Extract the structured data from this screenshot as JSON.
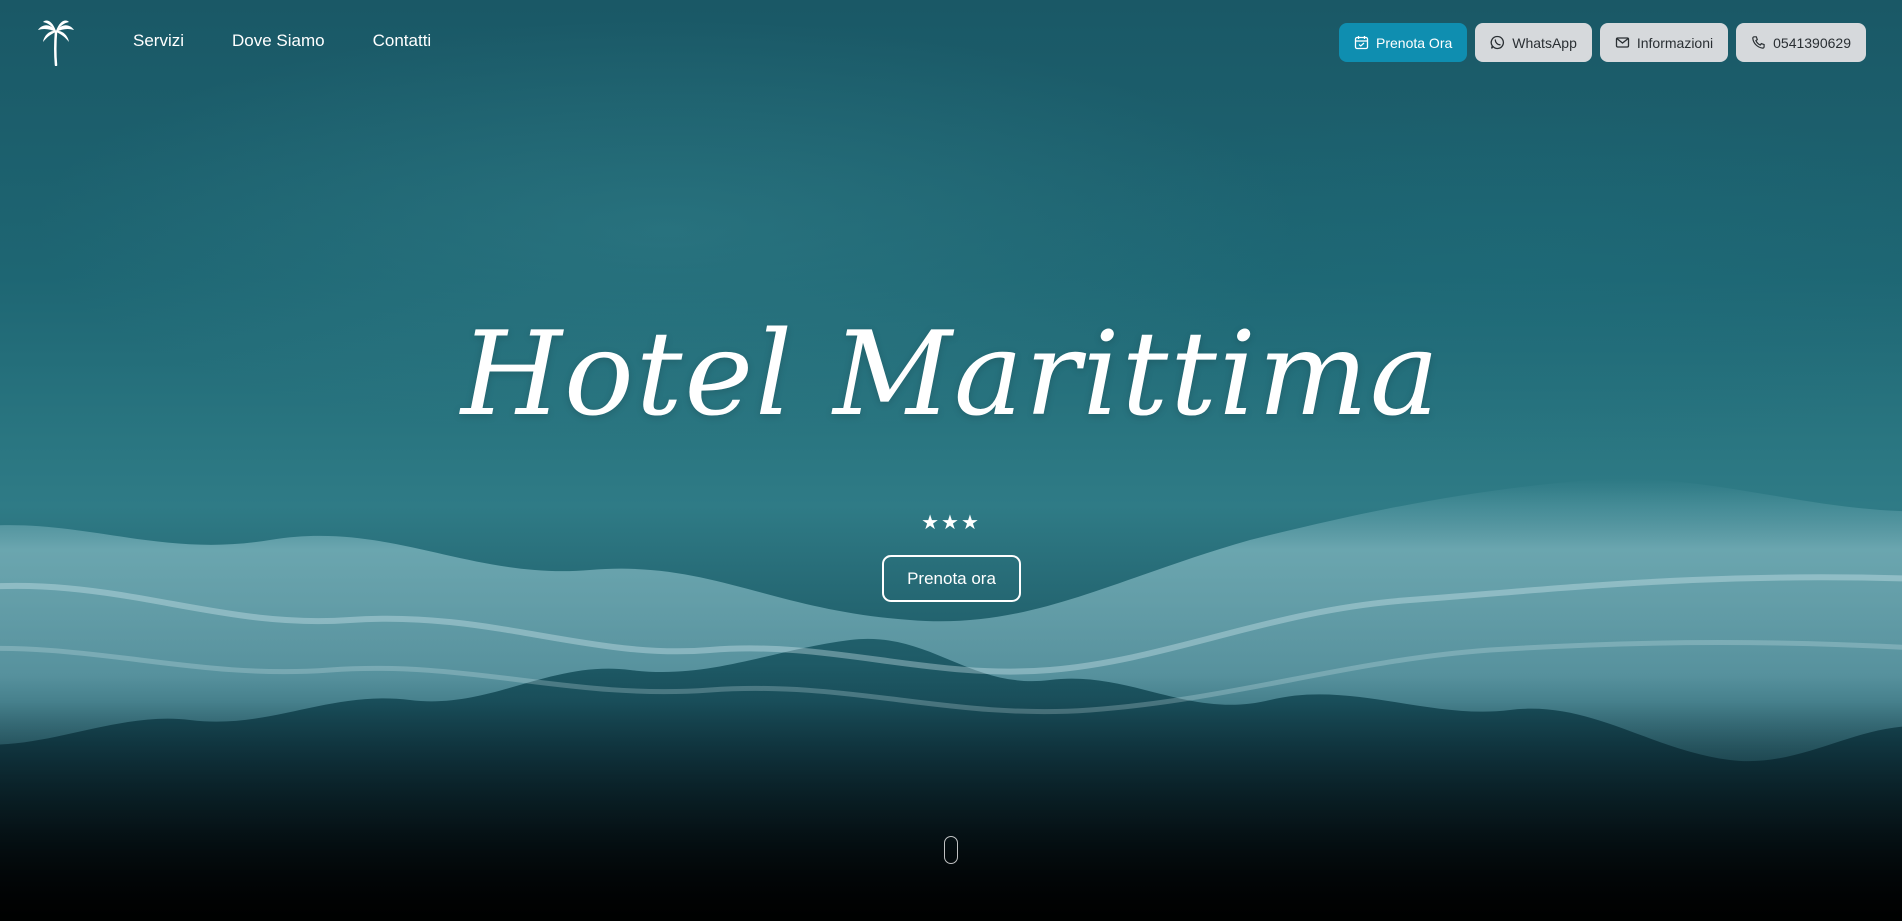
{
  "nav": {
    "items": [
      "Servizi",
      "Dove Siamo",
      "Contatti"
    ]
  },
  "actions": {
    "book": {
      "label": "Prenota Ora",
      "icon": "calendar-icon"
    },
    "whatsapp": {
      "label": "WhatsApp",
      "icon": "whatsapp-icon"
    },
    "info": {
      "label": "Informazioni",
      "icon": "mail-icon"
    },
    "phone": {
      "label": "0541390629",
      "icon": "phone-icon"
    }
  },
  "hero": {
    "title": "Hotel Marittima",
    "stars": "★★★",
    "cta_label": "Prenota ora"
  },
  "colors": {
    "primary": "#0f8eb0",
    "light_button": "#d6d9dc",
    "text_on_dark": "#ffffff"
  },
  "logo": {
    "icon": "palm-tree-icon"
  }
}
